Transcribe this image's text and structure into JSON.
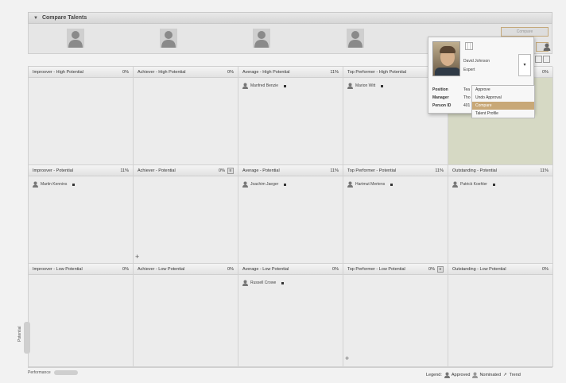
{
  "compare": {
    "title": "Compare Talents",
    "button_label": "Compare"
  },
  "cells": [
    {
      "title": "Improover - High Potential",
      "pct": "0%",
      "employees": []
    },
    {
      "title": "Achiever - High Potential",
      "pct": "0%",
      "employees": []
    },
    {
      "title": "Average - High Potential",
      "pct": "11%",
      "employees": [
        "Manfred Benzie"
      ]
    },
    {
      "title": "Top Performer - High Potential",
      "pct": "",
      "employees": [
        "Marion Witt"
      ]
    },
    {
      "title": "",
      "pct": "0%",
      "employees": []
    },
    {
      "title": "Improover - Potential",
      "pct": "11%",
      "employees": [
        "Martin Kennins"
      ]
    },
    {
      "title": "Achiever - Potential",
      "pct": "0%",
      "employees": []
    },
    {
      "title": "Average - Potential",
      "pct": "11%",
      "employees": [
        "Joachim Jaeger"
      ]
    },
    {
      "title": "Top Performer - Potential",
      "pct": "11%",
      "employees": [
        "Hartmut Mertens"
      ]
    },
    {
      "title": "Outstanding - Potential",
      "pct": "11%",
      "employees": [
        "Patrick Koehler"
      ]
    },
    {
      "title": "Improover - Low Potential",
      "pct": "0%",
      "employees": []
    },
    {
      "title": "Achiever - Low Potential",
      "pct": "0%",
      "employees": []
    },
    {
      "title": "Average - Low Potential",
      "pct": "0%",
      "employees": [
        "Russell Crowe"
      ]
    },
    {
      "title": "Top Performer - Low Potential",
      "pct": "0%",
      "employees": []
    },
    {
      "title": "Outstanding - Low Potential",
      "pct": "0%",
      "employees": []
    }
  ],
  "axes": {
    "vertical": "Potential",
    "horizontal": "Performance"
  },
  "legend": {
    "label": "Legend:",
    "approved": "Approved",
    "nominated": "Nominated",
    "trend": "Trend"
  },
  "popup": {
    "name": "David Johnson",
    "role": "Expert",
    "fields": [
      {
        "label": "Position",
        "value": "Tea"
      },
      {
        "label": "Manager",
        "value": "Tho"
      },
      {
        "label": "Person ID",
        "value": "401"
      }
    ],
    "menu": [
      "Approve",
      "Undo Approval",
      "Compare",
      "Talent Profile"
    ],
    "selected_menu": "Compare"
  },
  "colors": {
    "accent": "#c8a877",
    "highlight_cell": "#d6d9c4"
  }
}
